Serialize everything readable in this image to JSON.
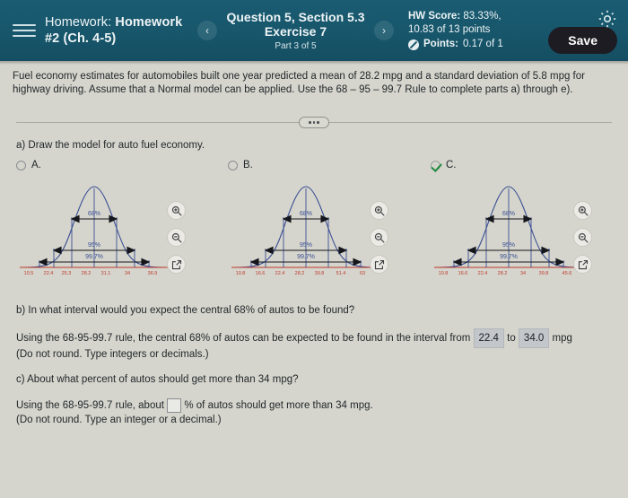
{
  "header": {
    "menu_icon": "hamburger-icon",
    "homework_label": "Homework:",
    "homework_name": "Homework #2 (Ch. 4-5)",
    "prev_icon": "‹",
    "next_icon": "›",
    "question_title": "Question 5, Section 5.3 Exercise 7",
    "question_part": "Part 3 of 5",
    "hw_score_label": "HW Score:",
    "hw_score_value": "83.33%,",
    "hw_points": "10.83 of 13 points",
    "points_label": "Points:",
    "points_value": "0.17 of 1",
    "gear_icon": "gear-icon",
    "save_label": "Save",
    "bg_color": "#17566b",
    "save_bg": "#1c1c22"
  },
  "problem": {
    "text": "Fuel economy estimates for automobiles built one year predicted a mean of 28.2 mpg and a standard deviation of 5.8 mpg for highway driving. Assume that a Normal model can be applied. Use the 68 – 95 – 99.7 Rule to complete parts a) through e)."
  },
  "part_a": {
    "question": "a) Draw the model for auto fuel economy.",
    "choices": [
      {
        "label": "A.",
        "selected": false,
        "band_labels": [
          "68%",
          "95%",
          "99.7%"
        ],
        "ticks": [
          "10.5",
          "22.4",
          "25.3",
          "28.2",
          "31.1",
          "34",
          "36.9"
        ]
      },
      {
        "label": "B.",
        "selected": false,
        "band_labels": [
          "68%",
          "95%",
          "99.7%"
        ],
        "ticks": [
          "10.8",
          "16.6",
          "22.4",
          "28.2",
          "39.8",
          "51.4",
          "63"
        ]
      },
      {
        "label": "C.",
        "selected": true,
        "band_labels": [
          "68%",
          "95%",
          "99.7%"
        ],
        "ticks": [
          "10.8",
          "16.6",
          "22.4",
          "28.2",
          "34",
          "39.8",
          "45.6"
        ]
      }
    ],
    "tools": [
      "zoom-in-icon",
      "zoom-out-icon",
      "open-popup-icon"
    ]
  },
  "part_b": {
    "question": "b) In what interval would you expect the central 68% of autos to be found?",
    "answer_prefix": "Using the 68-95-99.7 rule, the central 68% of autos can be expected to be found in the interval from",
    "lower_value": "22.4",
    "between": "to",
    "upper_value": "34.0",
    "units": "mpg",
    "note": "(Do not round. Type integers or decimals.)"
  },
  "part_c": {
    "question": "c) About what percent of autos should get more than 34 mpg?",
    "answer_prefix": "Using the 68-95-99.7 rule, about",
    "input_value": "",
    "answer_suffix": "% of autos should get more than 34 mpg.",
    "note": "(Do not round. Type an integer or a decimal.)"
  }
}
